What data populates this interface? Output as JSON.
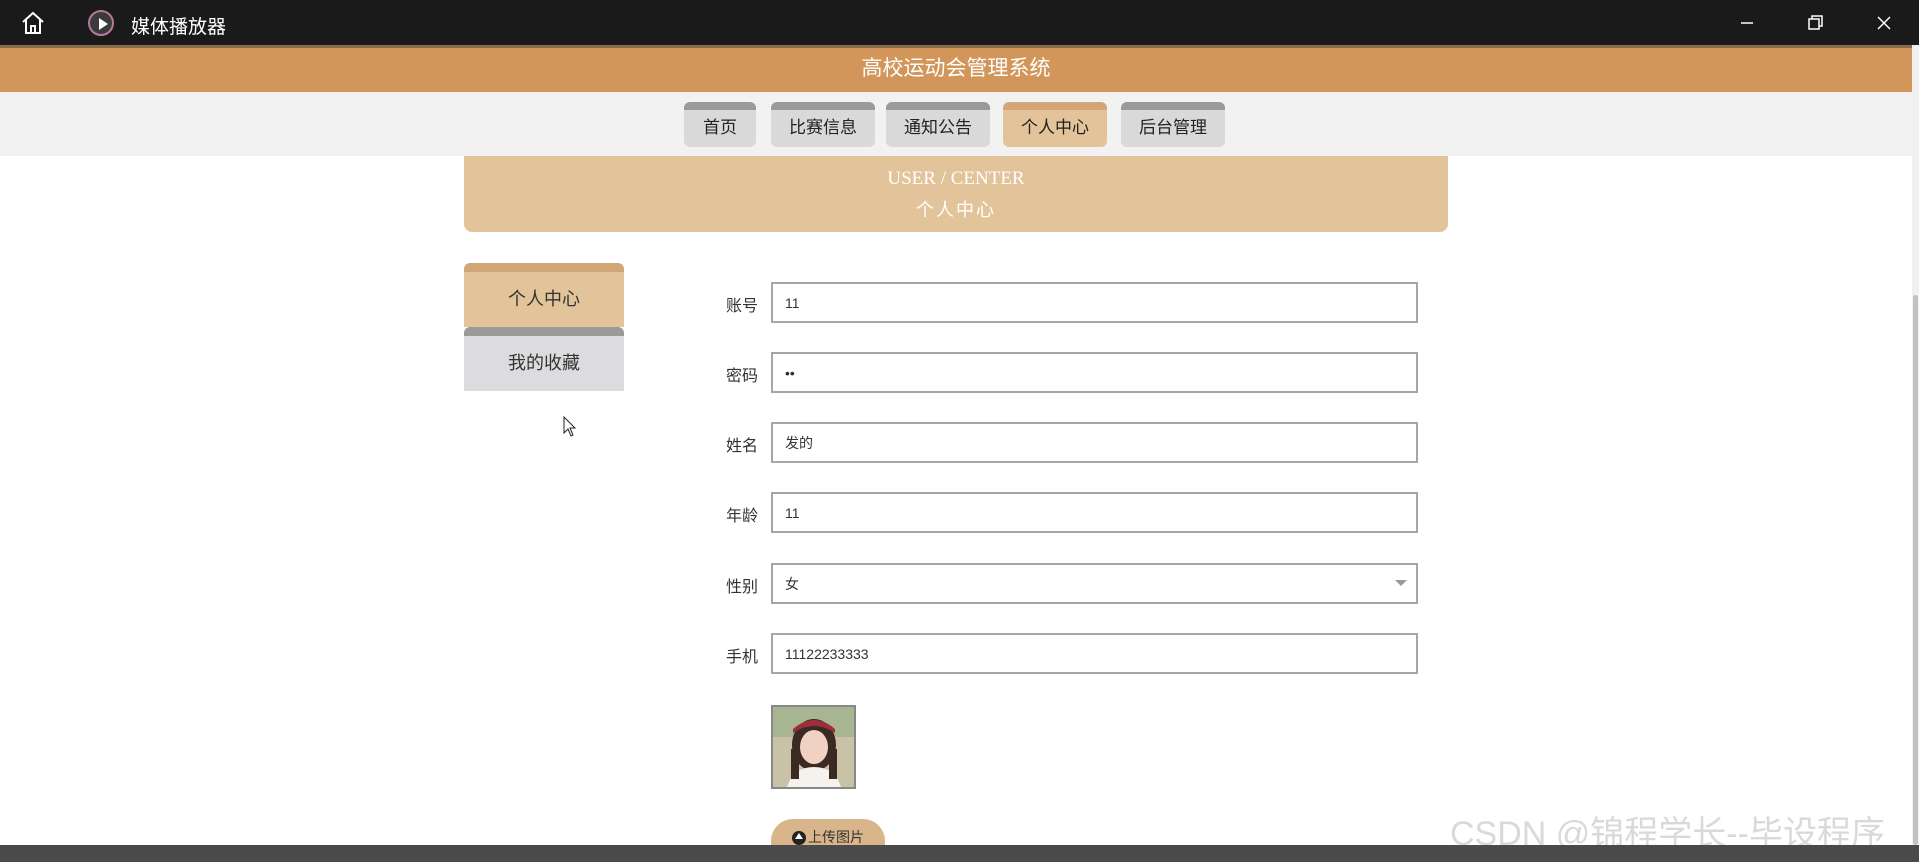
{
  "window": {
    "app_title": "媒体播放器",
    "icons": [
      "home-icon",
      "media-player-icon",
      "minimize-icon",
      "maximize-icon",
      "close-icon"
    ]
  },
  "site": {
    "title": "高校运动会管理系统",
    "nav": [
      {
        "label": "首页",
        "active": false
      },
      {
        "label": "比赛信息",
        "active": false
      },
      {
        "label": "通知公告",
        "active": false
      },
      {
        "label": "个人中心",
        "active": true
      },
      {
        "label": "后台管理",
        "active": false
      }
    ]
  },
  "banner": {
    "en": "USER / CENTER",
    "cn": "个人中心"
  },
  "sidebar": {
    "items": [
      {
        "label": "个人中心",
        "active": true
      },
      {
        "label": "我的收藏",
        "active": false
      }
    ]
  },
  "form": {
    "account": {
      "label": "账号",
      "value": "11"
    },
    "password": {
      "label": "密码",
      "value": "11"
    },
    "name": {
      "label": "姓名",
      "value": "发的"
    },
    "age": {
      "label": "年龄",
      "value": "11"
    },
    "gender": {
      "label": "性别",
      "value": "女"
    },
    "phone": {
      "label": "手机",
      "value": "11122233333"
    },
    "upload_label": "上传图片"
  },
  "watermark": "CSDN @锦程学长--毕设程序",
  "colors": {
    "accent": "#d2965a",
    "tab_active": "#e3c399",
    "tab_inactive": "#d9d9d9",
    "titlebar": "#1a1a1a"
  }
}
